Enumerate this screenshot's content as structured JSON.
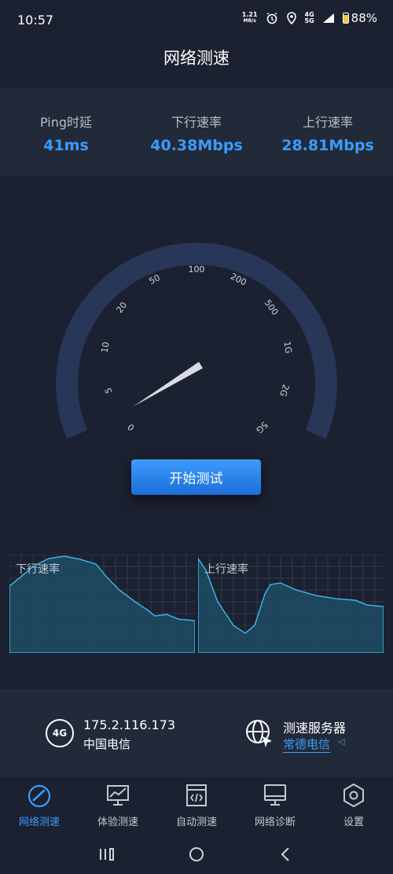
{
  "status": {
    "time": "10:57",
    "net_speed_value": "1.21",
    "net_speed_unit": "MB/s",
    "network_top": "4G",
    "network_bottom": "5G",
    "battery": "88%"
  },
  "header": {
    "title": "网络测速"
  },
  "stats": [
    {
      "label": "Ping时延",
      "value": "41ms"
    },
    {
      "label": "下行速率",
      "value": "40.38Mbps"
    },
    {
      "label": "上行速率",
      "value": "28.81Mbps"
    }
  ],
  "gauge": {
    "scale": [
      "0",
      "5",
      "10",
      "20",
      "50",
      "100",
      "200",
      "500",
      "1G",
      "2G",
      "5G"
    ]
  },
  "start_button": "开始测试",
  "graphs": {
    "download_label": "下行速率",
    "upload_label": "上行速率"
  },
  "network_info": {
    "badge": "4G",
    "ip": "175.2.116.173",
    "carrier": "中国电信"
  },
  "server": {
    "title": "测速服务器",
    "name": "常德电信"
  },
  "nav": [
    {
      "label": "网络测速",
      "icon": "speedometer-icon",
      "active": true
    },
    {
      "label": "体验测速",
      "icon": "chart-monitor-icon",
      "active": false
    },
    {
      "label": "自动测速",
      "icon": "code-doc-icon",
      "active": false
    },
    {
      "label": "网络诊断",
      "icon": "monitor-icon",
      "active": false
    },
    {
      "label": "设置",
      "icon": "hexagon-gear-icon",
      "active": false
    }
  ],
  "colors": {
    "background": "#1b2130",
    "panel": "#222a39",
    "accent": "#3a9cff",
    "gauge_ring": "#283657"
  }
}
